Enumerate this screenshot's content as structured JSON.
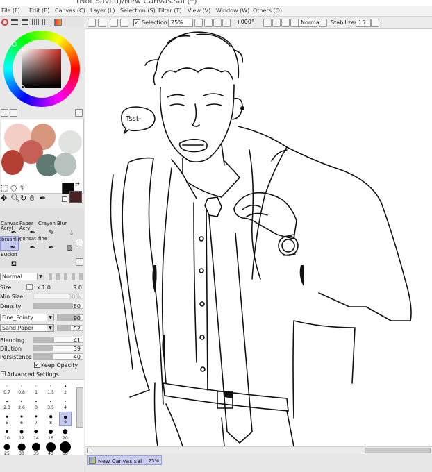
{
  "title": "(Not Saved)/New Canvas.sai (*)",
  "menu": [
    "File (F)",
    "Edit (E)",
    "Canvas (C)",
    "Layer (L)",
    "Selection (S)",
    "Filter (T)",
    "View (V)",
    "Window (W)",
    "Others (O)"
  ],
  "toolbar": {
    "selection_label": "Selection",
    "selection_checked": true,
    "zoom": "25%",
    "rotation": "+000°",
    "blend_mode": "Normal",
    "stabilizer_label": "Stabilizer",
    "stabilizer_value": "15"
  },
  "tools": [
    {
      "label": "Canvas",
      "sub": "Acryl"
    },
    {
      "label": "Paper",
      "sub": "Acryl"
    },
    {
      "label": "Crayon",
      "sub": ""
    },
    {
      "label": "Blur",
      "sub": ""
    },
    {
      "label": "brushlin",
      "sub": ""
    },
    {
      "label": "nonsat",
      "sub": ""
    },
    {
      "label": "fine",
      "sub": ""
    },
    {
      "label": "",
      "sub": ""
    },
    {
      "label": "Bucket",
      "sub": ""
    }
  ],
  "brush": {
    "mode": "Normal",
    "size_label": "Size",
    "size_multiplier": "x 1.0",
    "size_value": "9.0",
    "min_size_label": "Min Size",
    "min_size_value": "50%",
    "min_size_level": 50,
    "density_label": "Density",
    "density_value": "80",
    "density_level": 80,
    "shape": "Fine_Pointy",
    "shape_value": "90",
    "texture": "Sand Paper",
    "texture_value": "52",
    "blending_label": "Blending",
    "blending_value": "41",
    "dilution_label": "Dilution",
    "dilution_value": "39",
    "persistence_label": "Persistence",
    "persistence_value": "40",
    "keep_opacity_label": "Keep Opacity",
    "keep_opacity_checked": true,
    "advanced_label": "Advanced Settings"
  },
  "brush_sizes": [
    [
      "0.7",
      "0.8",
      "1",
      "1.5",
      "2"
    ],
    [
      "2.3",
      "2.6",
      "3",
      "3.5",
      "4"
    ],
    [
      "5",
      "6",
      "7",
      "8",
      "9"
    ],
    [
      "10",
      "12",
      "14",
      "16",
      "20"
    ],
    [
      "25",
      "30",
      "35",
      "40",
      "50"
    ]
  ],
  "selected_brush_size": "9",
  "canvas_text": "Tsst-",
  "document_tab": {
    "name": "New Canvas.sai",
    "zoom": "25%"
  },
  "colors": {
    "primary": "#0a0a0a",
    "secondary": "#4a2020",
    "swatches": [
      "#f2c9c1",
      "#d8967c",
      "#e0e3e0",
      "#c65f55",
      "#b34033",
      "#5e7a72",
      "#b6c2bd"
    ]
  }
}
